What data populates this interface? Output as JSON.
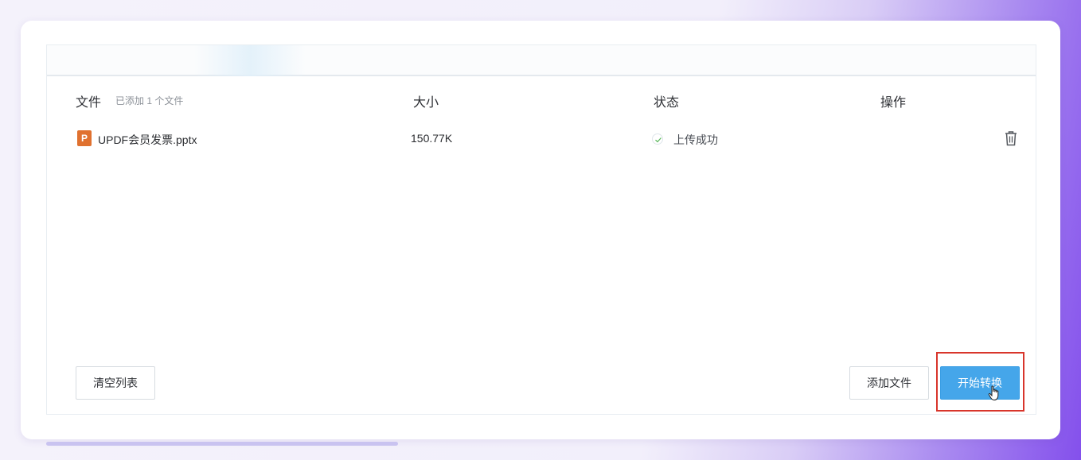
{
  "table": {
    "headers": {
      "file": "文件",
      "file_added": "已添加 1 个文件",
      "size": "大小",
      "status": "状态",
      "action": "操作"
    },
    "rows": [
      {
        "type_icon": "pptx-file-icon",
        "type_letter": "P",
        "name": "UPDF会员发票.pptx",
        "size": "150.77K",
        "status_icon": "check-circle-icon",
        "status": "上传成功",
        "action_icon": "trash-icon"
      }
    ]
  },
  "buttons": {
    "clear_list": "清空列表",
    "add_file": "添加文件",
    "start_convert": "开始转换"
  },
  "colors": {
    "primary": "#45a6ea",
    "pptx_icon": "#e0712f",
    "highlight_border": "#d8352b",
    "success_check": "#5cb85c"
  }
}
